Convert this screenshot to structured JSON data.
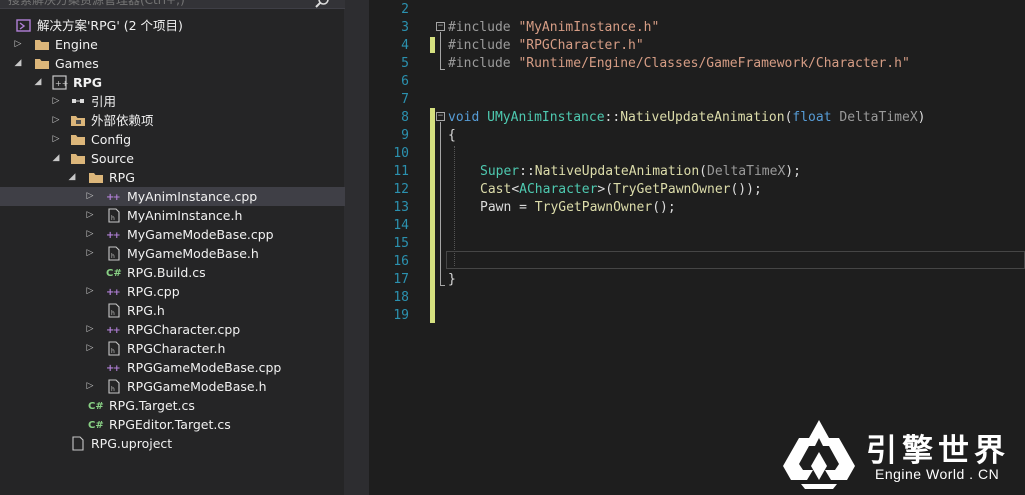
{
  "solution_explorer": {
    "search_placeholder": "搜索解决方案资源管理器(Ctrl+;)",
    "items": [
      {
        "label": "解决方案'RPG' (2 个项目)",
        "icon": "solution-icon",
        "arrow": "",
        "indent": 0
      },
      {
        "label": "Engine",
        "icon": "folder-icon",
        "arrow": "collapsed",
        "indent": 1
      },
      {
        "label": "Games",
        "icon": "folder-icon",
        "arrow": "expanded",
        "indent": 1
      },
      {
        "label": "RPG",
        "icon": "cpp-project-icon",
        "arrow": "expanded",
        "indent": 2,
        "bold": true
      },
      {
        "label": "引用",
        "icon": "references-icon",
        "arrow": "collapsed",
        "indent": 3
      },
      {
        "label": "外部依赖项",
        "icon": "external-deps-icon",
        "arrow": "collapsed",
        "indent": 3
      },
      {
        "label": "Config",
        "icon": "folder-icon",
        "arrow": "collapsed",
        "indent": 3
      },
      {
        "label": "Source",
        "icon": "folder-icon",
        "arrow": "expanded",
        "indent": 3
      },
      {
        "label": "RPG",
        "icon": "folder-icon",
        "arrow": "expanded",
        "indent": 4
      },
      {
        "label": "MyAnimInstance.cpp",
        "icon": "cpp-file-icon",
        "arrow": "collapsed",
        "indent": 5,
        "selected": true
      },
      {
        "label": "MyAnimInstance.h",
        "icon": "header-file-icon",
        "arrow": "collapsed",
        "indent": 5
      },
      {
        "label": "MyGameModeBase.cpp",
        "icon": "cpp-file-icon",
        "arrow": "collapsed",
        "indent": 5
      },
      {
        "label": "MyGameModeBase.h",
        "icon": "header-file-icon",
        "arrow": "collapsed",
        "indent": 5
      },
      {
        "label": "RPG.Build.cs",
        "icon": "csharp-file-icon",
        "arrow": "",
        "indent": 5
      },
      {
        "label": "RPG.cpp",
        "icon": "cpp-file-icon",
        "arrow": "collapsed",
        "indent": 5
      },
      {
        "label": "RPG.h",
        "icon": "header-file-icon",
        "arrow": "",
        "indent": 5
      },
      {
        "label": "RPGCharacter.cpp",
        "icon": "cpp-file-icon",
        "arrow": "collapsed",
        "indent": 5
      },
      {
        "label": "RPGCharacter.h",
        "icon": "header-file-icon",
        "arrow": "collapsed",
        "indent": 5
      },
      {
        "label": "RPGGameModeBase.cpp",
        "icon": "cpp-file-icon",
        "arrow": "",
        "indent": 5
      },
      {
        "label": "RPGGameModeBase.h",
        "icon": "header-file-icon",
        "arrow": "collapsed",
        "indent": 5
      },
      {
        "label": "RPG.Target.cs",
        "icon": "csharp-file-icon",
        "arrow": "",
        "indent": 4
      },
      {
        "label": "RPGEditor.Target.cs",
        "icon": "csharp-file-icon",
        "arrow": "",
        "indent": 4
      },
      {
        "label": "RPG.uproject",
        "icon": "file-icon",
        "arrow": "",
        "indent": 3
      }
    ]
  },
  "editor": {
    "line_numbers": [
      "2",
      "3",
      "4",
      "5",
      "6",
      "7",
      "8",
      "9",
      "10",
      "11",
      "12",
      "13",
      "14",
      "15",
      "16",
      "17",
      "18",
      "19"
    ],
    "code": {
      "l3_directive": "#include ",
      "l3_string": "\"MyAnimInstance.h\"",
      "l4_directive": "#include ",
      "l4_string": "\"RPGCharacter.h\"",
      "l5_directive": "#include ",
      "l5_string": "\"Runtime/Engine/Classes/GameFramework/Character.h\"",
      "l8_void": "void",
      "l8_class": "UMyAnimInstance",
      "l8_scope": "::",
      "l8_func": "NativeUpdateAnimation",
      "l8_open": "(",
      "l8_float": "float",
      "l8_param": " DeltaTimeX",
      "l8_close": ")",
      "l9_brace": "{",
      "l11_super": "Super",
      "l11_scope": "::",
      "l11_func": "NativeUpdateAnimation",
      "l11_open": "(",
      "l11_arg": "DeltaTimeX",
      "l11_close": ");",
      "l12_cast": "Cast",
      "l12_lt": "<",
      "l12_type": "ACharacter",
      "l12_gt": ">(",
      "l12_call": "TryGetPawnOwner",
      "l12_end": "());",
      "l13_lhs": "Pawn = ",
      "l13_call": "TryGetPawnOwner",
      "l13_end": "();",
      "l17_brace": "}"
    }
  },
  "watermark": {
    "title": "引擎世界",
    "subtitle": "Engine World . CN"
  },
  "colors": {
    "keyword": "#569cd6",
    "string": "#d69d85",
    "class": "#4ec9b0",
    "line_number": "#2b91af",
    "change_marker": "#d5e07f"
  }
}
